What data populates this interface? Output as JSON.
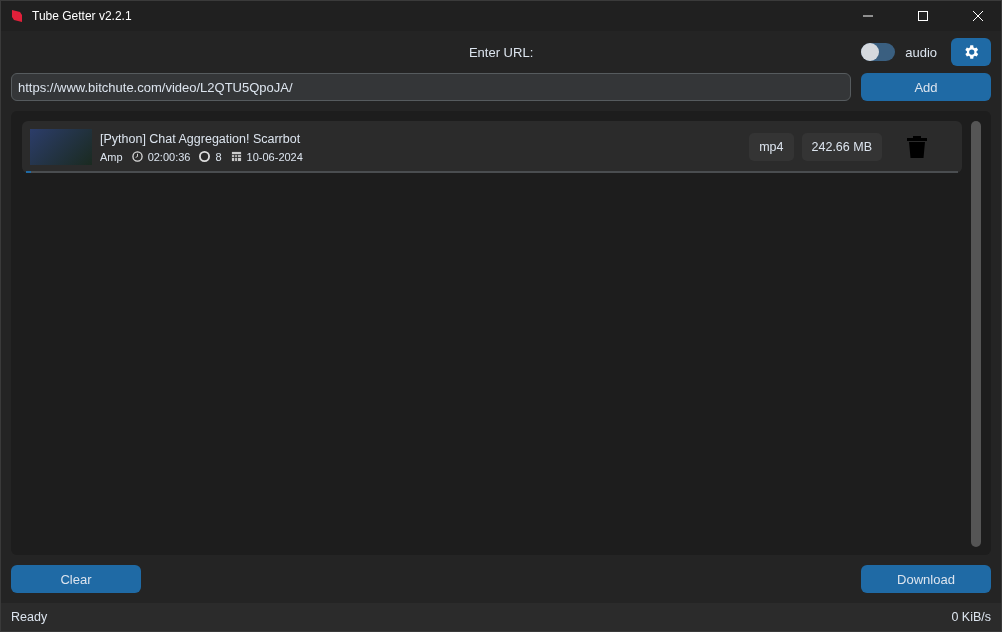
{
  "window": {
    "title": "Tube Getter v2.2.1"
  },
  "url_label": "Enter URL:",
  "audio": {
    "label": "audio",
    "on": false
  },
  "url_field": {
    "value": "https://www.bitchute.com/video/L2QTU5QpoJA/"
  },
  "add_button": "Add",
  "downloads": [
    {
      "title": "[Python] Chat Aggregation! Scarrbot",
      "channel": "Amp",
      "duration": "02:00:36",
      "views": "8",
      "date": "10-06-2024",
      "format": "mp4",
      "size": "242.66 MB",
      "level": 0.005
    }
  ],
  "clear_button": "Clear",
  "download_button": "Download",
  "status_bar": {
    "status": "Ready",
    "speed": "0 KiB/s"
  }
}
